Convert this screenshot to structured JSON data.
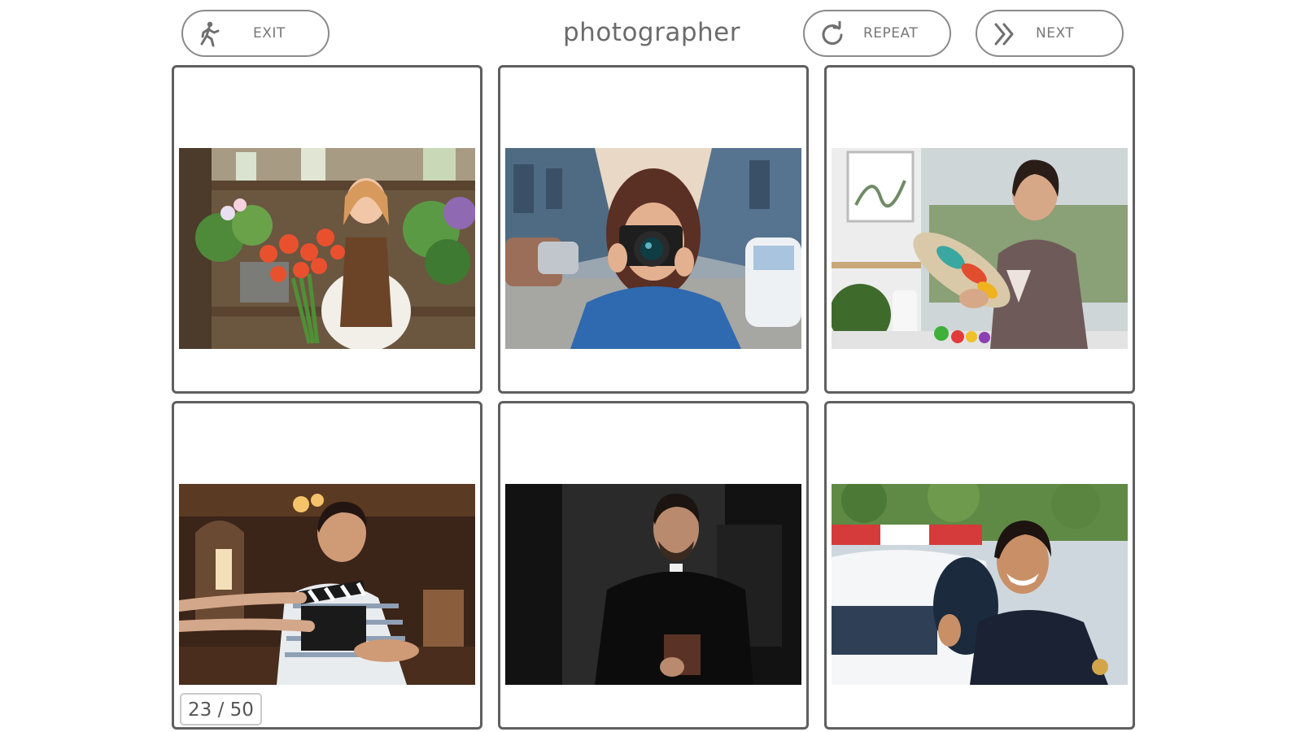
{
  "header": {
    "exit_label": "EXIT",
    "word": "photographer",
    "repeat_label": "REPEAT",
    "next_label": "NEXT"
  },
  "cards": [
    {
      "scene": "florist"
    },
    {
      "scene": "photographer"
    },
    {
      "scene": "painter"
    },
    {
      "scene": "film-director"
    },
    {
      "scene": "priest"
    },
    {
      "scene": "police-officer"
    }
  ],
  "progress": {
    "label": "23 / 50",
    "current": 23,
    "total": 50
  },
  "colors": {
    "border": "#5f5f5f",
    "text": "#6b6b6b",
    "button_border": "#8a8a8a"
  }
}
